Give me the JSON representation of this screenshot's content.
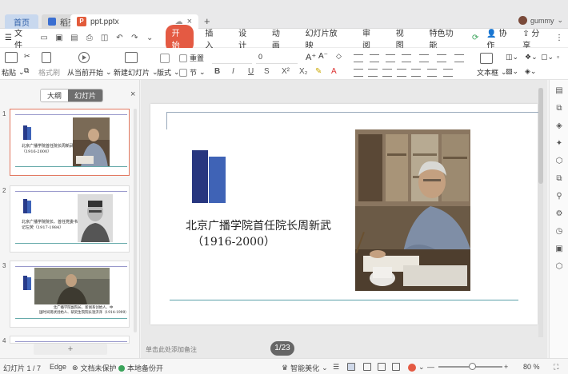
{
  "tabs": {
    "home": "首页",
    "straw": "稻壳",
    "file": "ppt.pptx",
    "user": "gummy"
  },
  "menu": {
    "file": "文件",
    "tabs": [
      "开始",
      "插入",
      "设计",
      "动画",
      "幻灯片放映",
      "审阅",
      "视图",
      "特色功能"
    ],
    "active_tab": "开始",
    "collab": "协作",
    "share": "分享"
  },
  "ribbon": {
    "paste": "粘贴",
    "format_painter": "格式刷",
    "play_from_current": "从当前开始",
    "new_slide": "新建幻灯片",
    "layout": "版式",
    "reset": "重置",
    "section": "节",
    "font_size": "0",
    "textbox": "文本框"
  },
  "left_panel": {
    "outline": "大纲",
    "slides": "幻灯片",
    "active_view": "幻灯片",
    "thumbnails": [
      {
        "num": "1",
        "line1": "北京广播学院首任院长周新武",
        "line2": "（1916-2000）"
      },
      {
        "num": "2",
        "line1": "北京广播学院院长、首任党委书",
        "line2": "记左荧（1917-1984）"
      },
      {
        "num": "3",
        "line1": "北广播学院副院长、新闻系创始人、中",
        "line2": "国时间现状创始人、研究生院院长温济泽（1914-1999）"
      },
      {
        "num": "4",
        "line1": "",
        "line2": ""
      }
    ]
  },
  "slide": {
    "title": "北京广播学院首任院长周新武",
    "subtitle": "（1916-2000）",
    "notes_placeholder": "单击此处添加备注",
    "page_indicator": "1/23"
  },
  "status": {
    "slide_count": "幻灯片 1 / 7",
    "theme": "Edge",
    "doc_protect": "文档未保护",
    "backup": "本地备份开",
    "beautify": "智能美化",
    "zoom": "80 %"
  },
  "colors": {
    "accent": "#e45a43",
    "logo_dark": "#27367f",
    "logo_light": "#3f63b6"
  }
}
